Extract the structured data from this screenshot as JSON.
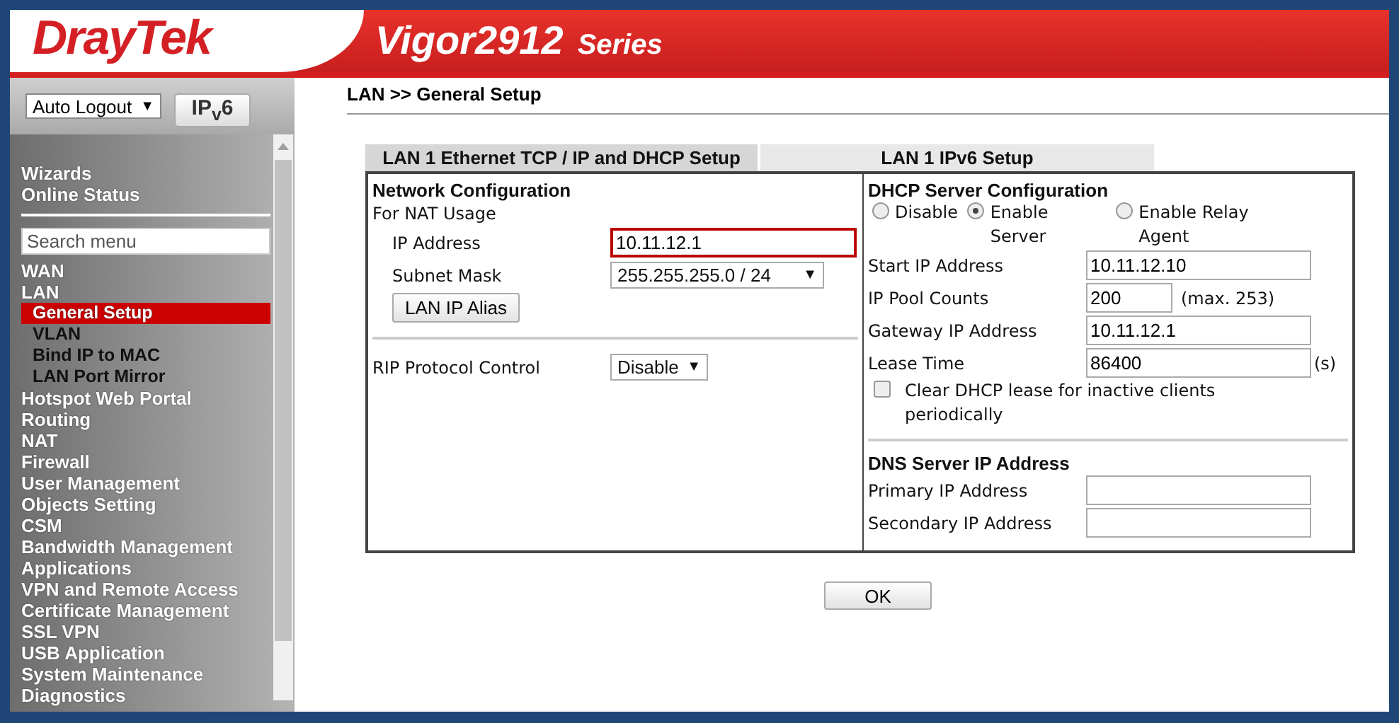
{
  "header": {
    "logo": "DrayTek",
    "model": "Vigor2912",
    "series": "Series"
  },
  "sidebar": {
    "auto_logout": {
      "value": "Auto Logout",
      "arrow": "▼"
    },
    "ipv6_button": {
      "label": "IP$_{v}$6"
    },
    "quick_links": [
      {
        "label": "Wizards",
        "selected": false
      },
      {
        "label": "Online Status",
        "selected": false
      }
    ],
    "search": {
      "placeholder": "Search menu"
    },
    "menu": [
      {
        "label": "WAN",
        "selected": false
      },
      {
        "label": "LAN",
        "selected": false,
        "children": [
          {
            "label": "General Setup",
            "selected": true
          },
          {
            "label": "VLAN",
            "selected": false
          },
          {
            "label": "Bind IP to MAC",
            "selected": false
          },
          {
            "label": "LAN Port Mirror",
            "selected": false
          }
        ]
      },
      {
        "label": "Hotspot Web Portal",
        "selected": false
      },
      {
        "label": "Routing",
        "selected": false
      },
      {
        "label": "NAT",
        "selected": false
      },
      {
        "label": "Firewall",
        "selected": false
      },
      {
        "label": "User Management",
        "selected": false
      },
      {
        "label": "Objects Setting",
        "selected": false
      },
      {
        "label": "CSM",
        "selected": false
      },
      {
        "label": "Bandwidth Management",
        "selected": false
      },
      {
        "label": "Applications",
        "selected": false
      },
      {
        "label": "VPN and Remote Access",
        "selected": false
      },
      {
        "label": "Certificate Management",
        "selected": false
      },
      {
        "label": "SSL VPN",
        "selected": false
      },
      {
        "label": "USB Application",
        "selected": false
      },
      {
        "label": "System Maintenance",
        "selected": false
      },
      {
        "label": "Diagnostics",
        "selected": false
      }
    ]
  },
  "breadcrumb": "LAN >> General Setup",
  "tabs": [
    {
      "label": "LAN 1 Ethernet TCP / IP and DHCP Setup",
      "selected": true
    },
    {
      "label": "LAN 1 IPv6 Setup",
      "selected": false
    }
  ],
  "network": {
    "title": "Network Configuration",
    "subtitle": "For NAT Usage",
    "ip_address": {
      "label": "IP Address",
      "value": "10.11.12.1",
      "focused": true
    },
    "subnet_mask": {
      "label": "Subnet Mask",
      "value": "255.255.255.0 / 24",
      "arrow": "▼"
    },
    "alias_button": "LAN IP Alias",
    "rip": {
      "label": "RIP Protocol Control",
      "value": "Disable",
      "arrow": "▼"
    }
  },
  "dhcp": {
    "title": "DHCP Server Configuration",
    "modes": [
      {
        "label": "Disable",
        "selected": false
      },
      {
        "label": "Enable Server",
        "selected": true
      },
      {
        "label": "Enable Relay Agent",
        "selected": false
      }
    ],
    "fields": [
      {
        "label": "Start IP Address",
        "value": "10.11.12.10",
        "kind": "wide"
      },
      {
        "label": "IP Pool Counts",
        "value": "200",
        "kind": "short",
        "suffix": "(max. 253)"
      },
      {
        "label": "Gateway IP Address",
        "value": "10.11.12.1",
        "kind": "wide"
      },
      {
        "label": "Lease Time",
        "value": "86400",
        "kind": "wide",
        "suffix": "(s)"
      }
    ],
    "clear_lease": {
      "label": "Clear DHCP lease for inactive clients periodically",
      "checked": false
    }
  },
  "dns": {
    "title": "DNS Server IP Address",
    "fields": [
      {
        "label": "Primary IP Address"
      },
      {
        "label": "Secondary IP Address"
      }
    ]
  },
  "ok_button": "OK"
}
